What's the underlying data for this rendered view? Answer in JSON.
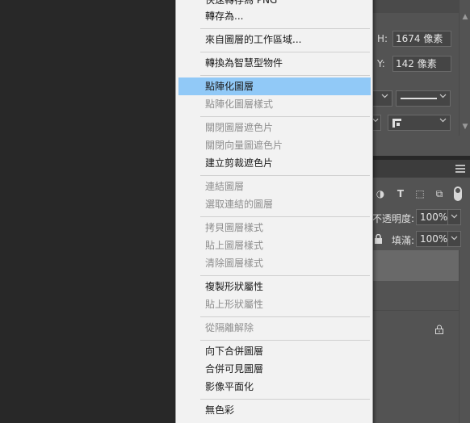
{
  "properties": {
    "h_label": "H:",
    "h_value": "1674 像素",
    "y_label": "Y:",
    "y_value": "142 像素",
    "scroll_up": "▲",
    "scroll_down": "▼",
    "dd_arrow": "⌵"
  },
  "layers_panel": {
    "opacity_label": "不透明度:",
    "opacity_value": "100%",
    "fill_label": "填滿:",
    "fill_value": "100%",
    "filter_icons": [
      "◑",
      "T",
      "⬚",
      "⧉"
    ]
  },
  "context_menu": {
    "items": [
      {
        "label": "快速轉存為 PNG",
        "disabled": false
      },
      {
        "label": "轉存為...",
        "disabled": false
      },
      {
        "label": "來自圖層的工作區域...",
        "disabled": false
      },
      {
        "label": "轉換為智慧型物件",
        "disabled": false
      },
      {
        "label": "點陣化圖層",
        "disabled": false,
        "highlighted": true
      },
      {
        "label": "點陣化圖層樣式",
        "disabled": true
      },
      {
        "label": "關閉圖層遮色片",
        "disabled": true
      },
      {
        "label": "關閉向量圖遮色片",
        "disabled": true
      },
      {
        "label": "建立剪裁遮色片",
        "disabled": false
      },
      {
        "label": "連結圖層",
        "disabled": true
      },
      {
        "label": "選取連結的圖層",
        "disabled": true
      },
      {
        "label": "拷貝圖層樣式",
        "disabled": true
      },
      {
        "label": "貼上圖層樣式",
        "disabled": true
      },
      {
        "label": "清除圖層樣式",
        "disabled": true
      },
      {
        "label": "複製形狀屬性",
        "disabled": false
      },
      {
        "label": "貼上形狀屬性",
        "disabled": true
      },
      {
        "label": "從隔離解除",
        "disabled": true
      },
      {
        "label": "向下合併圖層",
        "disabled": false
      },
      {
        "label": "合併可見圖層",
        "disabled": false
      },
      {
        "label": "影像平面化",
        "disabled": false
      },
      {
        "label": "無色彩",
        "disabled": false
      }
    ]
  }
}
